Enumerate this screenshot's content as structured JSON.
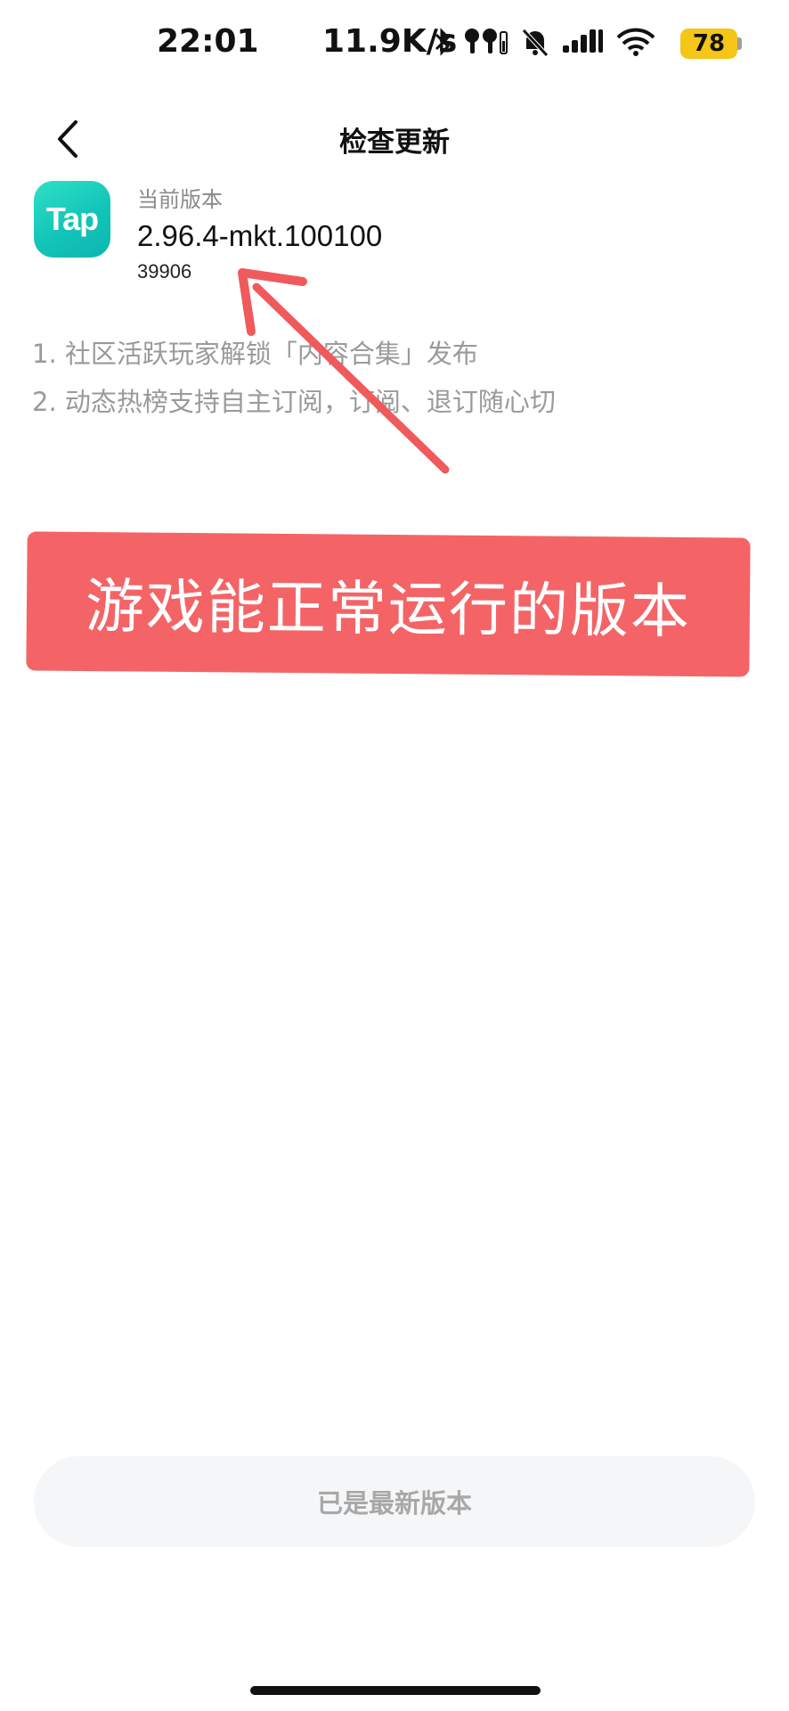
{
  "status_bar": {
    "time": "22:01",
    "net_speed": "11.9K/s",
    "battery_level": "78",
    "battery_color": "#f5c518",
    "icons": [
      "bluetooth-icon",
      "earbuds-icon",
      "mute-bell-icon",
      "signal-icon",
      "wifi-icon"
    ]
  },
  "nav": {
    "title": "检查更新",
    "back_icon": "chevron-left-icon"
  },
  "app": {
    "icon_text": "Tap",
    "icon_color": "#13c5b8",
    "version_label": "当前版本",
    "version": "2.96.4-mkt.100100",
    "build": "39906"
  },
  "release_notes": [
    "1. 社区活跃玩家解锁「内容合集」发布",
    "2. 动态热榜支持自主订阅，订阅、退订随心切"
  ],
  "annotation": {
    "caption": "游戏能正常运行的版本",
    "banner_color": "#f46466",
    "arrow_color": "#f05a5c"
  },
  "bottom_button": {
    "label": "已是最新版本"
  }
}
